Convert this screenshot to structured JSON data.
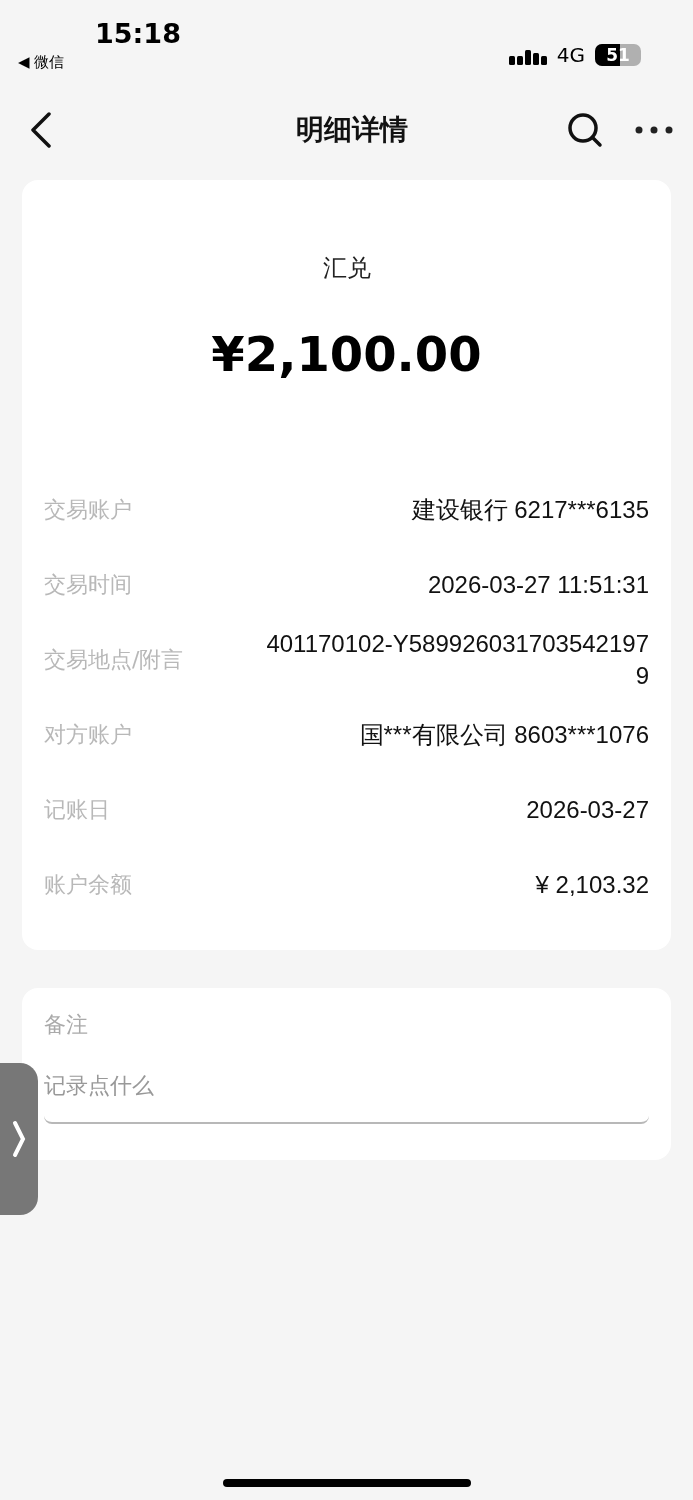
{
  "status_bar": {
    "time": "15:18",
    "back_app": "◀ 微信",
    "network": "4G",
    "battery": "51"
  },
  "nav": {
    "title": "明细详情"
  },
  "summary": {
    "type": "汇兑",
    "amount": "¥2,100.00"
  },
  "details": [
    {
      "label": "交易账户",
      "value": "建设银行 6217***6135"
    },
    {
      "label": "交易时间",
      "value": "2026-03-27 11:51:31"
    },
    {
      "label": "交易地点/附言",
      "value": "401170102-Y5899260317035421979"
    },
    {
      "label": "对方账户",
      "value": "国***有限公司 8603***1076"
    },
    {
      "label": "记账日",
      "value": "2026-03-27"
    },
    {
      "label": "账户余额",
      "value": "¥ 2,103.32"
    }
  ],
  "note": {
    "label": "备注",
    "placeholder": "记录点什么"
  }
}
